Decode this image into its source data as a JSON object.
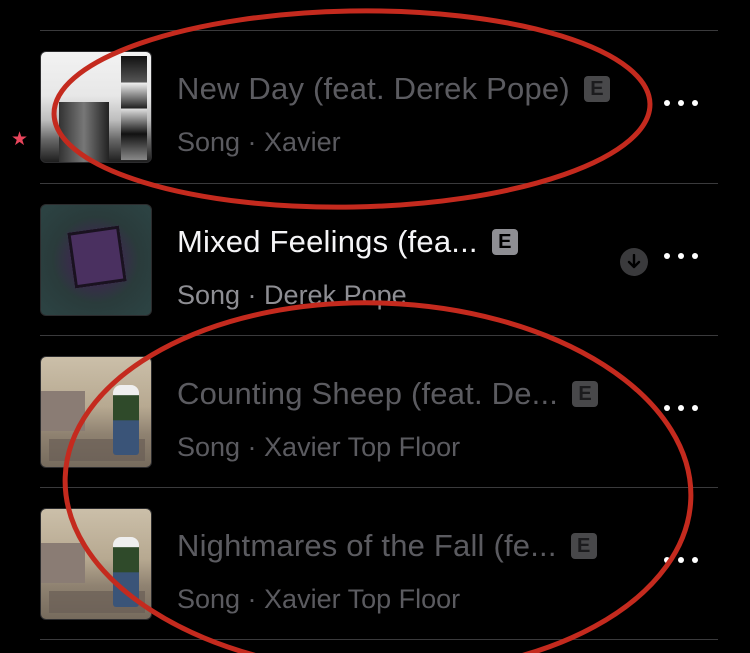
{
  "results": [
    {
      "title": "New Day (feat. Derek Pope)",
      "explicit": "E",
      "subtitle": "Song · Xavier",
      "style": "dim",
      "starred": true,
      "downloaded": false,
      "artwork": "album-art-building"
    },
    {
      "title": "Mixed Feelings (fea...",
      "explicit": "E",
      "subtitle": "Song · Derek Pope",
      "style": "bright",
      "starred": false,
      "downloaded": true,
      "artwork": "album-art-purple-cube"
    },
    {
      "title": "Counting Sheep (feat. De...",
      "explicit": "E",
      "subtitle": "Song · Xavier Top Floor",
      "style": "dim",
      "starred": false,
      "downloaded": false,
      "artwork": "album-art-living-room"
    },
    {
      "title": "Nightmares of the Fall (fe...",
      "explicit": "E",
      "subtitle": "Song · Xavier Top Floor",
      "style": "dim",
      "starred": false,
      "downloaded": false,
      "artwork": "album-art-living-room"
    }
  ],
  "icons": {
    "star": "star-icon",
    "more": "more-icon",
    "download": "download-icon"
  },
  "colors": {
    "background": "#000000",
    "dim_text": "#5b5b60",
    "bright_text": "#f5f5f7",
    "secondary_text": "#8e8e93",
    "star": "#e8455c",
    "annotation": "#c42a1e"
  }
}
